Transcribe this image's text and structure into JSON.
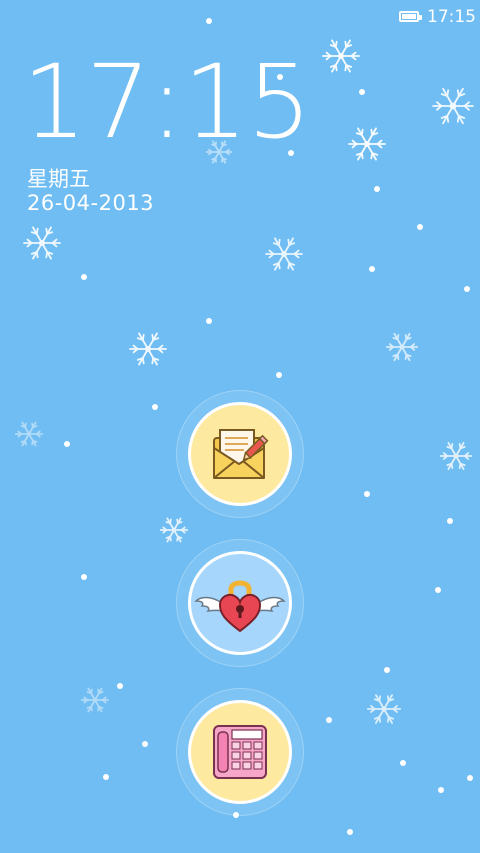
{
  "status_bar": {
    "time": "17:15",
    "battery_level": 1.0
  },
  "clock": {
    "time": "17:15",
    "weekday": "星期五",
    "date": "26-04-2013"
  },
  "shortcuts": [
    {
      "name": "messages",
      "icon": "envelope-letter-icon",
      "color": "#fde9a0"
    },
    {
      "name": "unlock",
      "icon": "winged-heart-lock-icon",
      "color": "#a6d6fb"
    },
    {
      "name": "phone",
      "icon": "pink-phone-icon",
      "color": "#fde9a0"
    }
  ],
  "colors": {
    "background": "#6fbdf2",
    "text": "#ffffff"
  }
}
